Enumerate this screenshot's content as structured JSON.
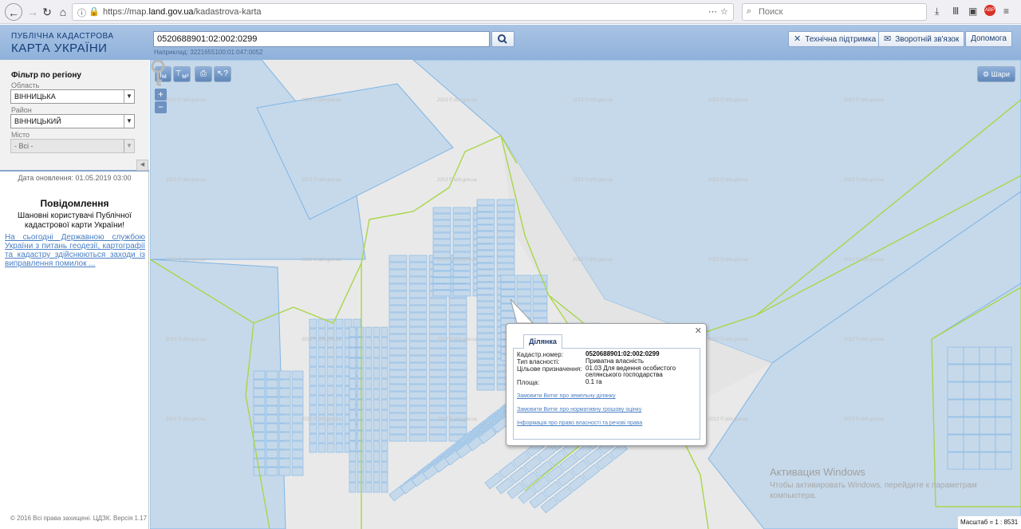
{
  "browser": {
    "back_icon": "back-arrow-icon",
    "url_scheme": "https://map.",
    "url_host": "land.gov.ua",
    "url_path": "/kadastrova-karta",
    "search_placeholder": "Поиск"
  },
  "header": {
    "logo_line1": "ПУБЛІЧНА КАДАСТРОВА",
    "logo_line2": "КАРТА УКРАЇНИ",
    "search_value": "0520688901:02:002:0299",
    "search_hint": "Наприклад: 3221655100:01:047:0052",
    "support_label": "Технічна підтримка",
    "feedback_label": "Зворотній зв'язок",
    "help_label": "Допомога"
  },
  "filter": {
    "title": "Фільтр по регіону",
    "region_label": "Область",
    "region_value": "ВІННИЦЬКА",
    "district_label": "Район",
    "district_value": "ВІННИЦЬКИЙ",
    "city_label": "Місто",
    "city_value": "- Всі -"
  },
  "left": {
    "update_date": "Дата оновлення: 01.05.2019 03:00",
    "notice_title": "Повідомлення",
    "notice_greeting": "Шановні користувачі Публічної кадастрової карти України!",
    "notice_link": "На сьогодні Державною службою України з питань геодезії, картографії та кадастру здійснюються заходи із виправлення помилок ...",
    "copyright": "© 2016 Всі права захищені. ЦДЗК. Версія 1.17"
  },
  "map": {
    "tool_ruler": "м",
    "tool_area": "м²",
    "zoom_in": "+",
    "zoom_out": "−",
    "layers_label": "Шари",
    "watermark_text": "2013 © dzk.gov.ua",
    "scale_label": "Масштаб = 1 : 8531"
  },
  "popup": {
    "tab_label": "Ділянка",
    "rows": [
      {
        "label": "Кадастр.номер:",
        "value": "0520688901:02:002:0299"
      },
      {
        "label": "Тип власності:",
        "value": "Приватна власність"
      },
      {
        "label": "Цільове призначення:",
        "value": "01.03 Для ведення особистого селянського господарства"
      },
      {
        "label": "Площа:",
        "value": "0.1 га"
      }
    ],
    "link1": "Замовити Витяг про земельну ділянку",
    "link2": "Замовити Витяг про нормативну грошову оцінку",
    "link3": "Інформація про право власності та речові права"
  },
  "windows": {
    "title": "Активация Windows",
    "subtitle": "Чтобы активировать Windows, перейдите к параметрам компьютера."
  },
  "colors": {
    "parcel_fill": "#c6d9ea",
    "parcel_stroke": "#7fb5e6",
    "boundary": "#a8d64a",
    "header_bg": "#9db9df"
  }
}
